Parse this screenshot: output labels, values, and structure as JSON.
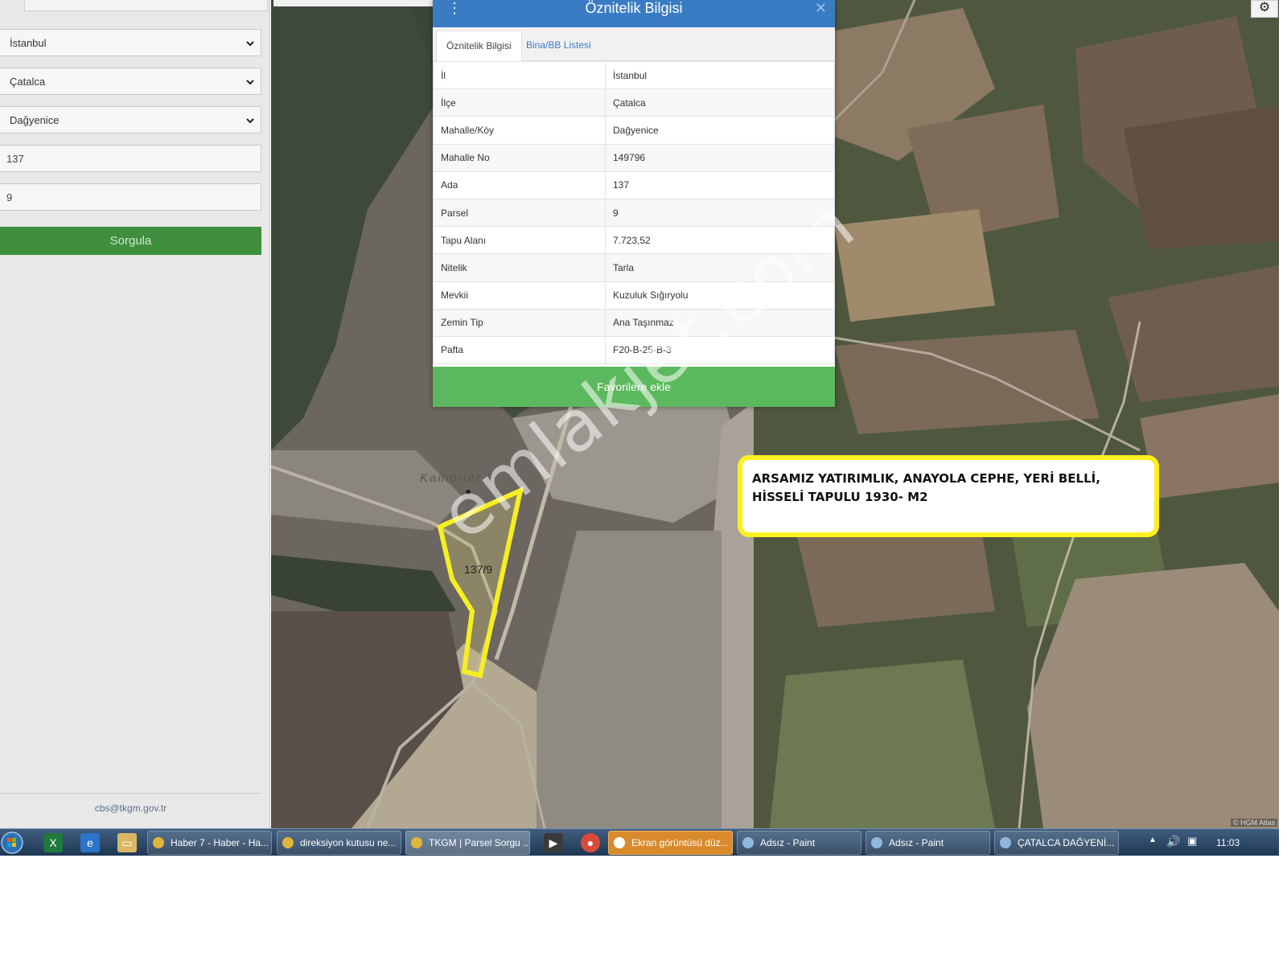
{
  "sidebar": {
    "province_select": "İstanbul",
    "district_select": "Çatalca",
    "neighborhood_select": "Dağyenice",
    "block_input": "137",
    "parcel_input": "9",
    "query_button": "Sorgula",
    "footer_email": "cbs@tkgm.gov.tr"
  },
  "popup": {
    "title": "Öznitelik Bilgisi",
    "tabs": [
      "Öznitelik Bilgisi",
      "Bina/BB Listesi"
    ],
    "rows": [
      {
        "key": "İl",
        "value": "İstanbul"
      },
      {
        "key": "İlçe",
        "value": "Çatalca"
      },
      {
        "key": "Mahalle/Köy",
        "value": "Dağyenice"
      },
      {
        "key": "Mahalle No",
        "value": "149796"
      },
      {
        "key": "Ada",
        "value": "137"
      },
      {
        "key": "Parsel",
        "value": "9"
      },
      {
        "key": "Tapu Alanı",
        "value": "7.723,52"
      },
      {
        "key": "Nitelik",
        "value": "Tarla"
      },
      {
        "key": "Mevkii",
        "value": "Kuzuluk Sığıryolu"
      },
      {
        "key": "Zemin Tip",
        "value": "Ana Taşınmaz"
      },
      {
        "key": "Pafta",
        "value": "F20-B-25-B-3"
      }
    ],
    "favorite_button": "Favorilere ekle"
  },
  "map": {
    "parcel_label": "137/9",
    "place_label": "Kamörler T",
    "attribution": "© HGM Atlas",
    "watermark": "emlakjet.com"
  },
  "callout": {
    "text": "ARSAMIZ YATIRIMLIK, ANAYOLA CEPHE,  YERİ BELLİ, HİSSELİ TAPULU 1930- M2"
  },
  "taskbar": {
    "items": [
      "Haber 7 - Haber - Ha...",
      "direksiyon kutusu ne...",
      "TKGM | Parsel Sorgu ...",
      "Ekran görüntüsü düz...",
      "Adsız - Paint",
      "Adsız - Paint",
      "ÇATALCA DAĞYENİ..."
    ],
    "clock": "11:03"
  },
  "colors": {
    "header_blue": "#3a7cc4",
    "query_green": "#3f8f3f",
    "favorite_green": "#5cb85c",
    "callout_yellow": "#ffef1f"
  }
}
